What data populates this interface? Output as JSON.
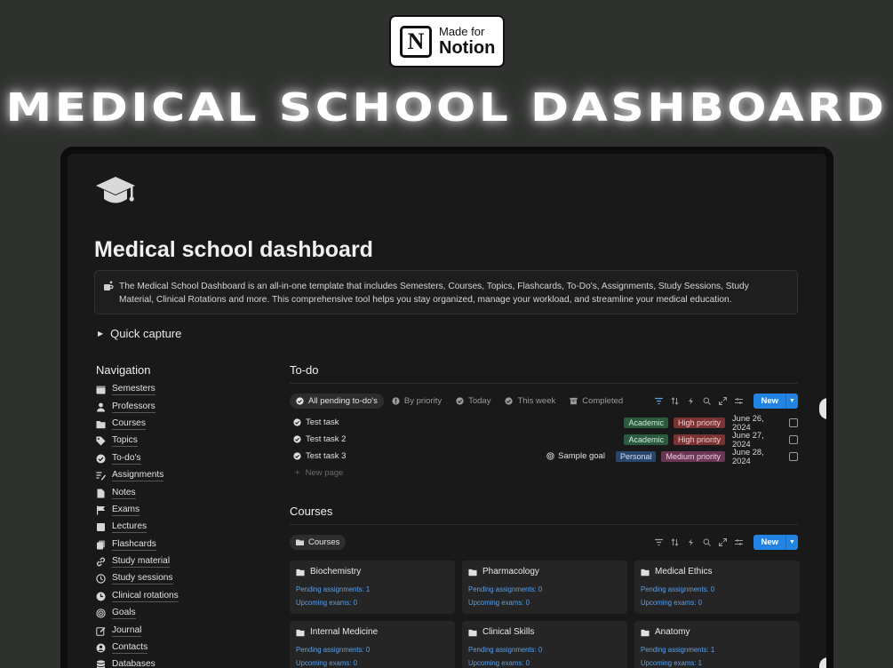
{
  "badge": {
    "made": "Made for",
    "notion": "Notion",
    "logo_letter": "N"
  },
  "hero_title": "MEDICAL SCHOOL DASHBOARD",
  "page": {
    "icon": "graduation-cap-icon",
    "title": "Medical school dashboard",
    "callout_icon": "mug-icon",
    "callout": "The Medical School Dashboard is an all-in-one template that includes Semesters, Courses, Topics, Flashcards, To-Do's, Assignments, Study Sessions, Study Material, Clinical Rotations and more. This comprehensive tool helps you stay organized, manage your workload, and streamline your medical education.",
    "quick_capture": "Quick capture"
  },
  "nav": {
    "heading": "Navigation",
    "items": [
      {
        "label": "Semesters",
        "icon": "calendar-icon"
      },
      {
        "label": "Professors",
        "icon": "person-icon"
      },
      {
        "label": "Courses",
        "icon": "folder-icon"
      },
      {
        "label": "Topics",
        "icon": "tag-icon"
      },
      {
        "label": "To-do's",
        "icon": "check-circle-icon"
      },
      {
        "label": "Assignments",
        "icon": "list-pen-icon"
      },
      {
        "label": "Notes",
        "icon": "document-icon"
      },
      {
        "label": "Exams",
        "icon": "flag-icon"
      },
      {
        "label": "Lectures",
        "icon": "square-icon"
      },
      {
        "label": "Flashcards",
        "icon": "cards-icon"
      },
      {
        "label": "Study material",
        "icon": "link-icon"
      },
      {
        "label": "Study sessions",
        "icon": "clock-icon"
      },
      {
        "label": "Clinical rotations",
        "icon": "pie-clock-icon"
      },
      {
        "label": "Goals",
        "icon": "target-icon"
      },
      {
        "label": "Journal",
        "icon": "edit-icon"
      },
      {
        "label": "Contacts",
        "icon": "contact-icon"
      },
      {
        "label": "Databases",
        "icon": "database-icon"
      }
    ]
  },
  "todo": {
    "title": "To-do",
    "views": [
      {
        "label": "All pending to-do's",
        "icon": "check-circle-icon"
      },
      {
        "label": "By priority",
        "icon": "alert-circle-icon"
      },
      {
        "label": "Today",
        "icon": "check-circle-icon"
      },
      {
        "label": "This week",
        "icon": "check-circle-icon"
      },
      {
        "label": "Completed",
        "icon": "archive-icon"
      }
    ],
    "new_label": "New",
    "tasks": [
      {
        "name": "Test task",
        "goal": "",
        "tags": [
          {
            "label": "Academic",
            "bg": "#2b5a3f",
            "fg": "#cfe9d8"
          },
          {
            "label": "High priority",
            "bg": "#7a3232",
            "fg": "#f2cfcf"
          }
        ],
        "date": "June 26, 2024"
      },
      {
        "name": "Test task 2",
        "goal": "",
        "tags": [
          {
            "label": "Academic",
            "bg": "#2b5a3f",
            "fg": "#cfe9d8"
          },
          {
            "label": "High priority",
            "bg": "#7a3232",
            "fg": "#f2cfcf"
          }
        ],
        "date": "June 27, 2024"
      },
      {
        "name": "Test task 3",
        "goal": "Sample goal",
        "tags": [
          {
            "label": "Personal",
            "bg": "#28456b",
            "fg": "#cfe0f5"
          },
          {
            "label": "Medium priority",
            "bg": "#6b3554",
            "fg": "#f1d1e3"
          }
        ],
        "date": "June 28, 2024"
      }
    ],
    "new_page": "New page"
  },
  "courses": {
    "title": "Courses",
    "view": "Courses",
    "new_label": "New",
    "cards": [
      {
        "name": "Biochemistry",
        "pending": "Pending assignments: 1",
        "exams": "Upcoming exams: 0"
      },
      {
        "name": "Pharmacology",
        "pending": "Pending assignments: 0",
        "exams": "Upcoming exams: 0"
      },
      {
        "name": "Medical Ethics",
        "pending": "Pending assignments: 0",
        "exams": "Upcoming exams: 0"
      },
      {
        "name": "Internal Medicine",
        "pending": "Pending assignments: 0",
        "exams": "Upcoming exams: 0"
      },
      {
        "name": "Clinical Skills",
        "pending": "Pending assignments: 0",
        "exams": "Upcoming exams: 0"
      },
      {
        "name": "Anatomy",
        "pending": "Pending assignments: 1",
        "exams": "Upcoming exams: 1"
      }
    ]
  },
  "colors": {
    "accent": "#2383e2",
    "link": "#5b9fe6",
    "background": "#2f312f",
    "window": "#191919"
  }
}
